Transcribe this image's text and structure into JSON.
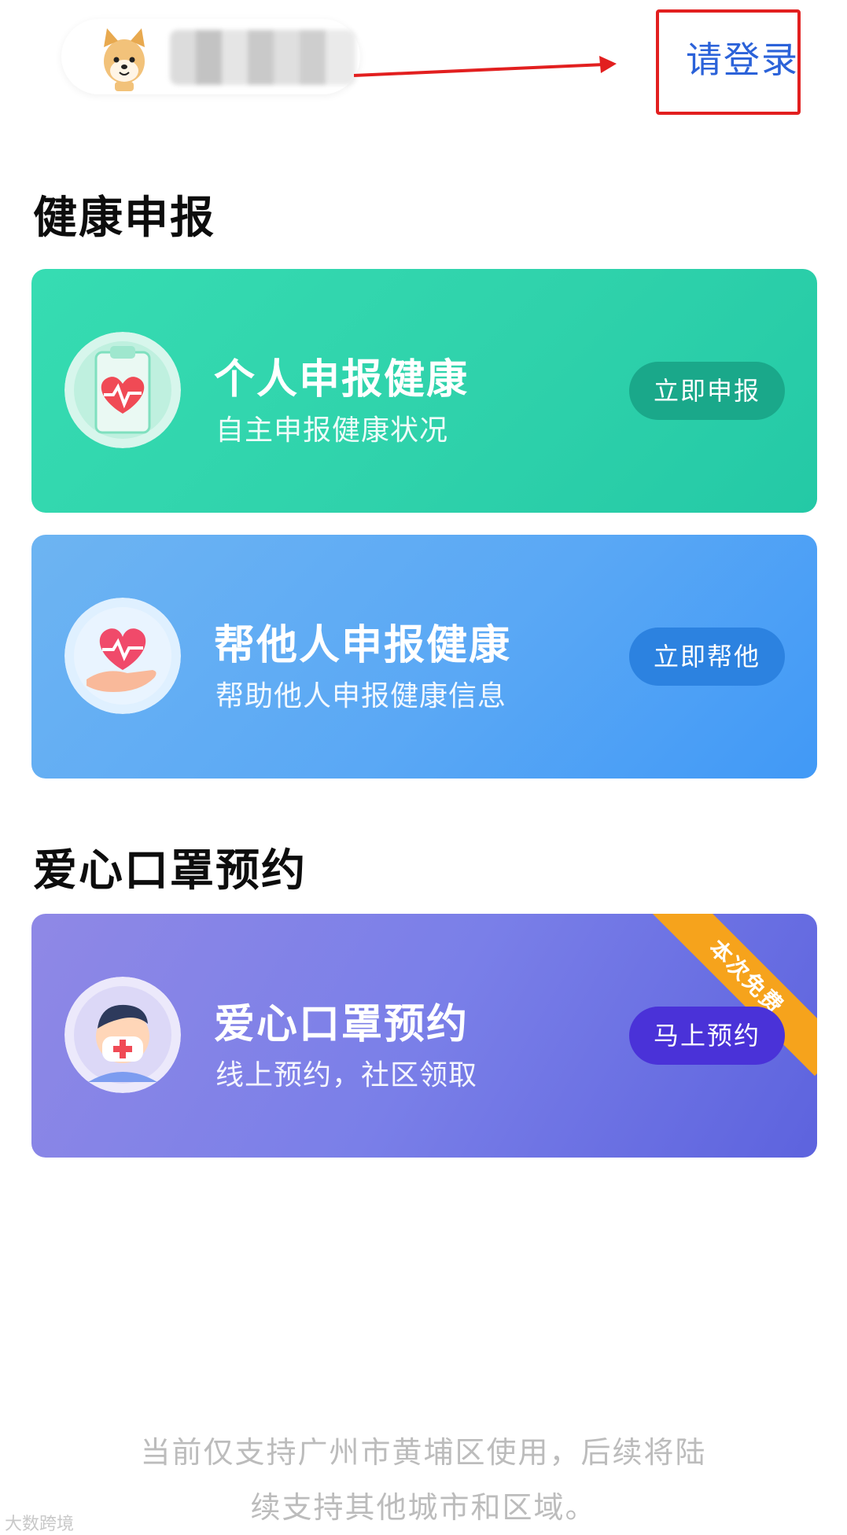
{
  "header": {
    "login_label": "请登录"
  },
  "sections": {
    "health_title": "健康申报",
    "mask_title": "爱心口罩预约"
  },
  "cards": {
    "personal": {
      "title": "个人申报健康",
      "subtitle": "自主申报健康状况",
      "button": "立即申报",
      "icon": "clipboard-heart-icon",
      "color": "#33d6ae"
    },
    "others": {
      "title": "帮他人申报健康",
      "subtitle": "帮助他人申报健康信息",
      "button": "立即帮他",
      "icon": "hand-heart-icon",
      "color": "#5aa8f5"
    },
    "mask": {
      "title": "爱心口罩预约",
      "subtitle": "线上预约，社区领取",
      "button": "马上预约",
      "badge": "本次免费",
      "icon": "masked-person-icon",
      "color": "#7a7fe8"
    }
  },
  "footer": {
    "note_line1": "当前仅支持广州市黄埔区使用，后续将陆",
    "note_line2": "续支持其他城市和区域。",
    "watermark": "大数跨境"
  },
  "colors": {
    "login_link": "#2b62d9",
    "annotation_red": "#e21f1f",
    "badge_orange": "#f6a31c"
  }
}
